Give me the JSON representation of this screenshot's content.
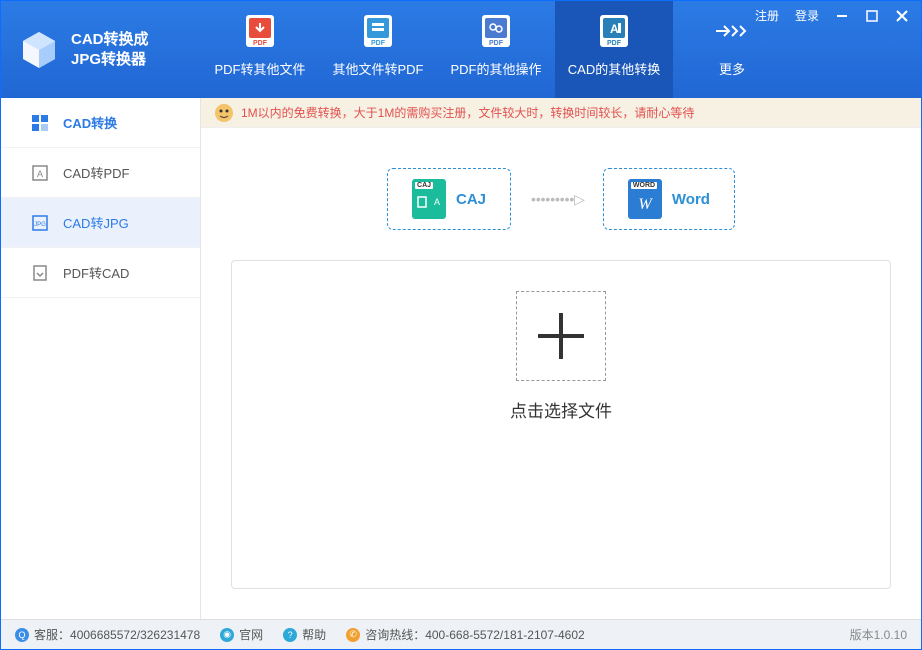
{
  "app": {
    "title1": "CAD转换成",
    "title2": "JPG转换器"
  },
  "toolbar": {
    "items": [
      {
        "label": "PDF转其他文件"
      },
      {
        "label": "其他文件转PDF"
      },
      {
        "label": "PDF的其他操作"
      },
      {
        "label": "CAD的其他转换"
      },
      {
        "label": "更多"
      }
    ]
  },
  "wincontrols": {
    "register": "注册",
    "login": "登录"
  },
  "sidebar": {
    "items": [
      {
        "label": "CAD转换"
      },
      {
        "label": "CAD转PDF"
      },
      {
        "label": "CAD转JPG"
      },
      {
        "label": "PDF转CAD"
      }
    ]
  },
  "notice": "1M以内的免费转换，大于1M的需购买注册，文件较大时，转换时间较长，请耐心等待",
  "conversion": {
    "from": "CAJ",
    "to": "Word",
    "from_badge": "CAJ",
    "to_badge": "WORD"
  },
  "drop": {
    "text": "点击选择文件"
  },
  "footer": {
    "service_label": "客服：",
    "service_value": "4006685572/326231478",
    "site": "官网",
    "help": "帮助",
    "hotline_label": "咨询热线：",
    "hotline_value": "400-668-5572/181-2107-4602",
    "version": "版本1.0.10"
  }
}
